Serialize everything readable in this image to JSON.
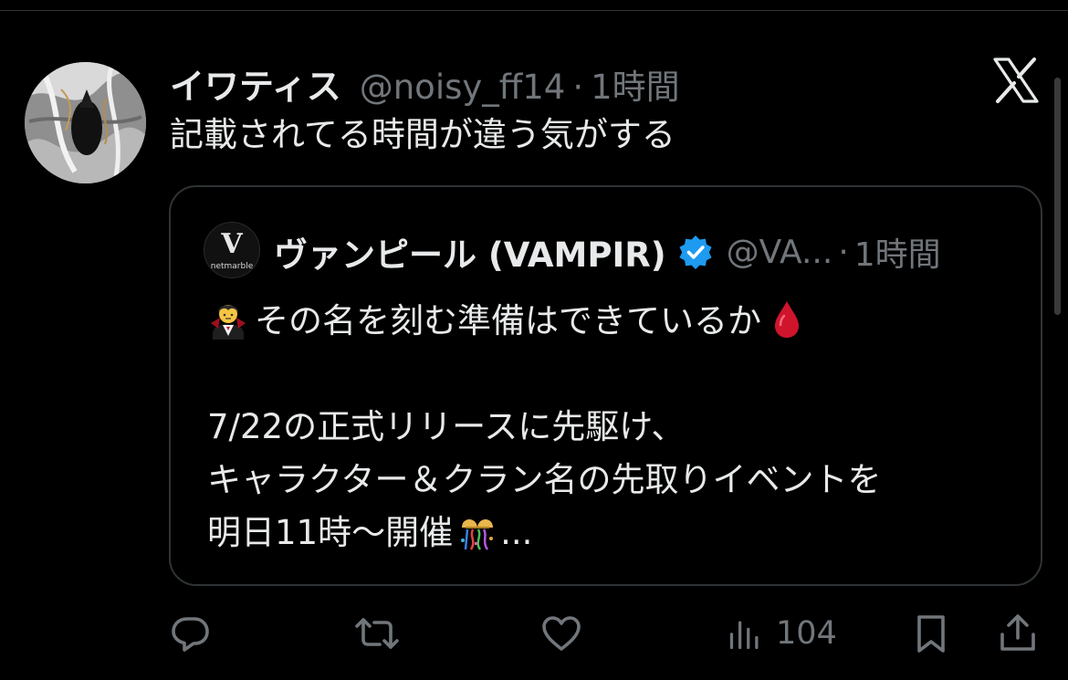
{
  "tweet": {
    "display_name": "イワティス",
    "handle": "@noisy_ff14",
    "separator": "·",
    "time": "1時間",
    "text": "記載されてる時間が違う気がする",
    "avatar_icon": "abstract-avatar-image"
  },
  "quote": {
    "avatar_letter": "V",
    "avatar_brand": "netmarble",
    "display_name": "ヴァンピール (VAMPIR)",
    "verified_icon": "verified-badge-icon",
    "handle": "@VA...",
    "separator": "·",
    "time": "1時間",
    "line1": "その名を刻む準備はできているか",
    "line2": "7/22の正式リリースに先駆け、",
    "line3": "キャラクター＆クラン名の先取りイベントを",
    "line4_text": "明日11時〜開催",
    "line4_tail": "..."
  },
  "actions": {
    "reply_icon": "reply-icon",
    "retweet_icon": "retweet-icon",
    "like_icon": "heart-icon",
    "views_icon": "views-icon",
    "views_count": "104",
    "bookmark_icon": "bookmark-icon",
    "share_icon": "share-icon"
  },
  "platform": {
    "logo": "x-logo-icon"
  },
  "colors": {
    "background": "#000000",
    "text_primary": "#e7e9ea",
    "text_secondary": "#71767b",
    "border": "#2f3336",
    "verified": "#1d9bf0",
    "drop": "#d0142c"
  }
}
